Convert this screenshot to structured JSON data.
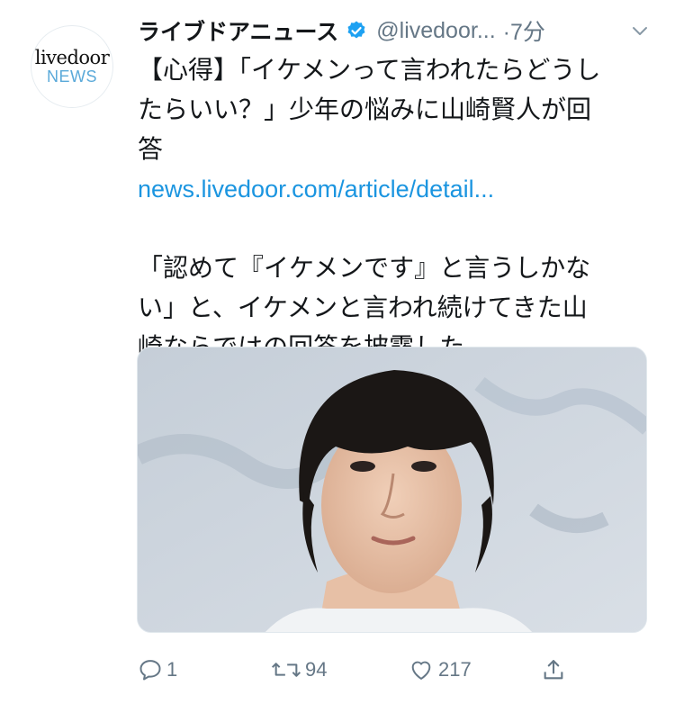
{
  "author": {
    "avatar_line1": "livedoor",
    "avatar_line2": "NEWS",
    "name": "ライブドアニュース",
    "handle": "@livedoor...",
    "time": "·7分"
  },
  "tweet": {
    "line1": "【心得】「イケメンって言われたらどうし",
    "line2": "たらいい？」少年の悩みに山崎賢人が回",
    "line3": "答",
    "link": "news.livedoor.com/article/detail...",
    "line4": "「認めて『イケメンです』と言うしかな",
    "line5": "い」と、イケメンと言われ続けてきた山",
    "line6": "崎ならではの回答を披露した。"
  },
  "actions": {
    "reply_count": "1",
    "retweet_count": "94",
    "like_count": "217"
  },
  "colors": {
    "link": "#1b95e0",
    "secondary": "#657786",
    "verified": "#1da1f2"
  },
  "icons": [
    "verified-badge-icon",
    "chevron-down-icon",
    "reply-icon",
    "retweet-icon",
    "like-icon",
    "share-icon"
  ]
}
